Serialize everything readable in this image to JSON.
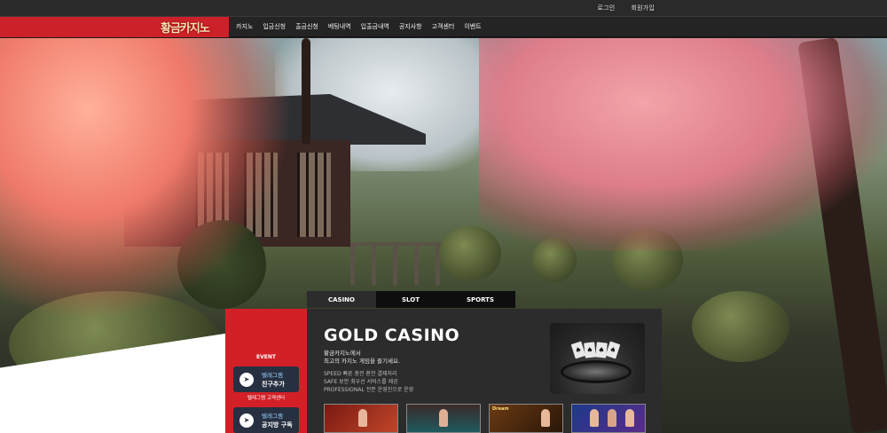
{
  "topbar": {
    "login": "로그인",
    "signup": "회원가입"
  },
  "logo": "황금카지노",
  "nav": [
    "카지노",
    "입금신청",
    "출금신청",
    "베팅내역",
    "입출금내역",
    "공지사항",
    "고객센터",
    "이벤트"
  ],
  "tabs": [
    "CASINO",
    "SLOT",
    "SPORTS"
  ],
  "event": {
    "label": "EVENT",
    "buttons": [
      {
        "line1": "텔레그램",
        "line2": "친구추가"
      },
      {
        "line1": "텔레그램",
        "line2": "공지방 구독"
      }
    ],
    "sub": "텔레그램 고객센터"
  },
  "main": {
    "title": "GOLD CASINO",
    "intro": [
      "황금카지노에서",
      "최고의 카지노 게임을 즐기세요."
    ],
    "features": [
      "SPEED 빠른 충전 환전 결제처리",
      "SAFE 보안 최우선 서비스를 제공",
      "PROFESSIONAL 전문 운영진으로 운영"
    ]
  },
  "games": [
    {
      "label": "",
      "color": "#7a1a12"
    },
    {
      "label": "",
      "color": "#1f5a5e"
    },
    {
      "label": "Dream",
      "color": "#6b3a12"
    },
    {
      "label": "",
      "color": "#1c3a8a"
    }
  ]
}
